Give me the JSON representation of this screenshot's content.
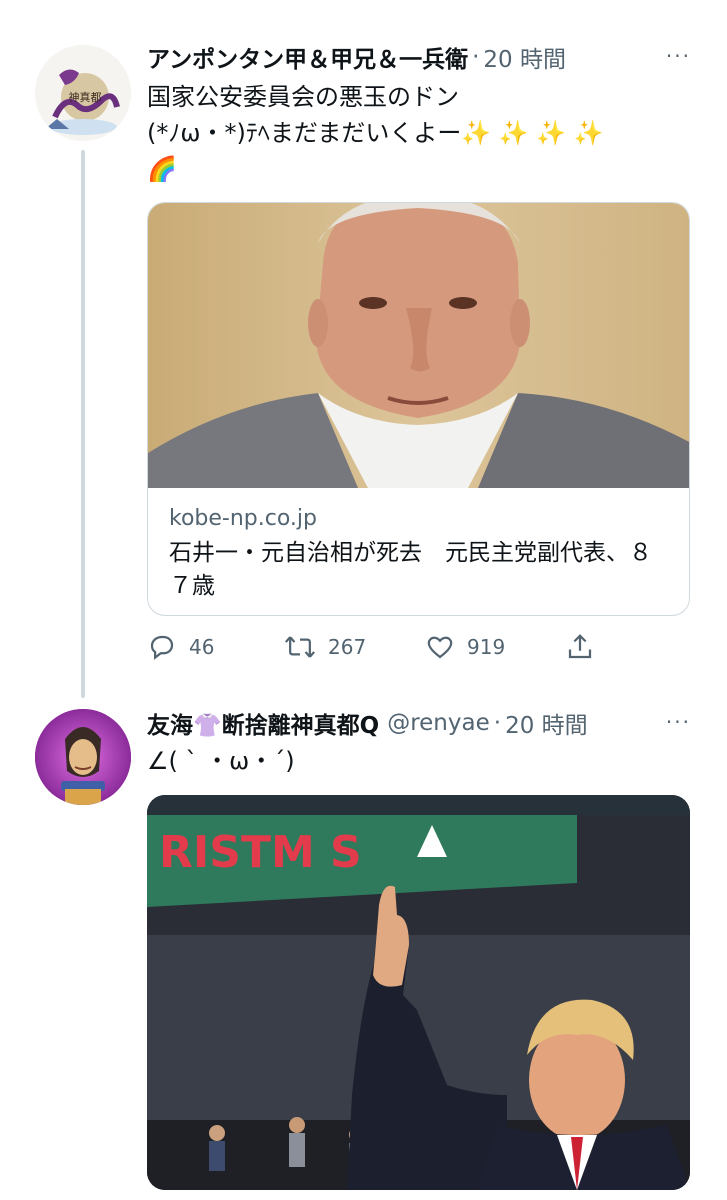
{
  "tweet1": {
    "name": "アンポンタン甲＆甲兄＆一兵衛",
    "separator": "·",
    "time": "20 時間",
    "more": "···",
    "line1": "国家公安委員会の悪玉のドン",
    "line2": "(*ﾉω・*)ﾃﾍまだまだいくよー✨ ✨ ✨ ✨",
    "line3": "🌈",
    "avatar_text": "神真都",
    "card": {
      "domain": "kobe-np.co.jp",
      "title": "石井一・元自治相が死去　元民主党副代表、８７歳"
    },
    "actions": {
      "reply_icon": "reply-icon",
      "reply_count": "46",
      "retweet_icon": "retweet-icon",
      "retweet_count": "267",
      "like_icon": "heart-icon",
      "like_count": "919",
      "share_icon": "share-icon"
    }
  },
  "tweet2": {
    "name": "友海👚断捨離神真都Q",
    "handle": "@renyae",
    "separator": "·",
    "time": "20 時間",
    "more": "···",
    "text": "∠( ˋ ・ω・ˊ)",
    "photo_banner": "RISTM S"
  },
  "colors": {
    "text": "#0f1419",
    "secondary": "#536471",
    "border": "#cfd9de",
    "thread": "#cfd9de"
  }
}
